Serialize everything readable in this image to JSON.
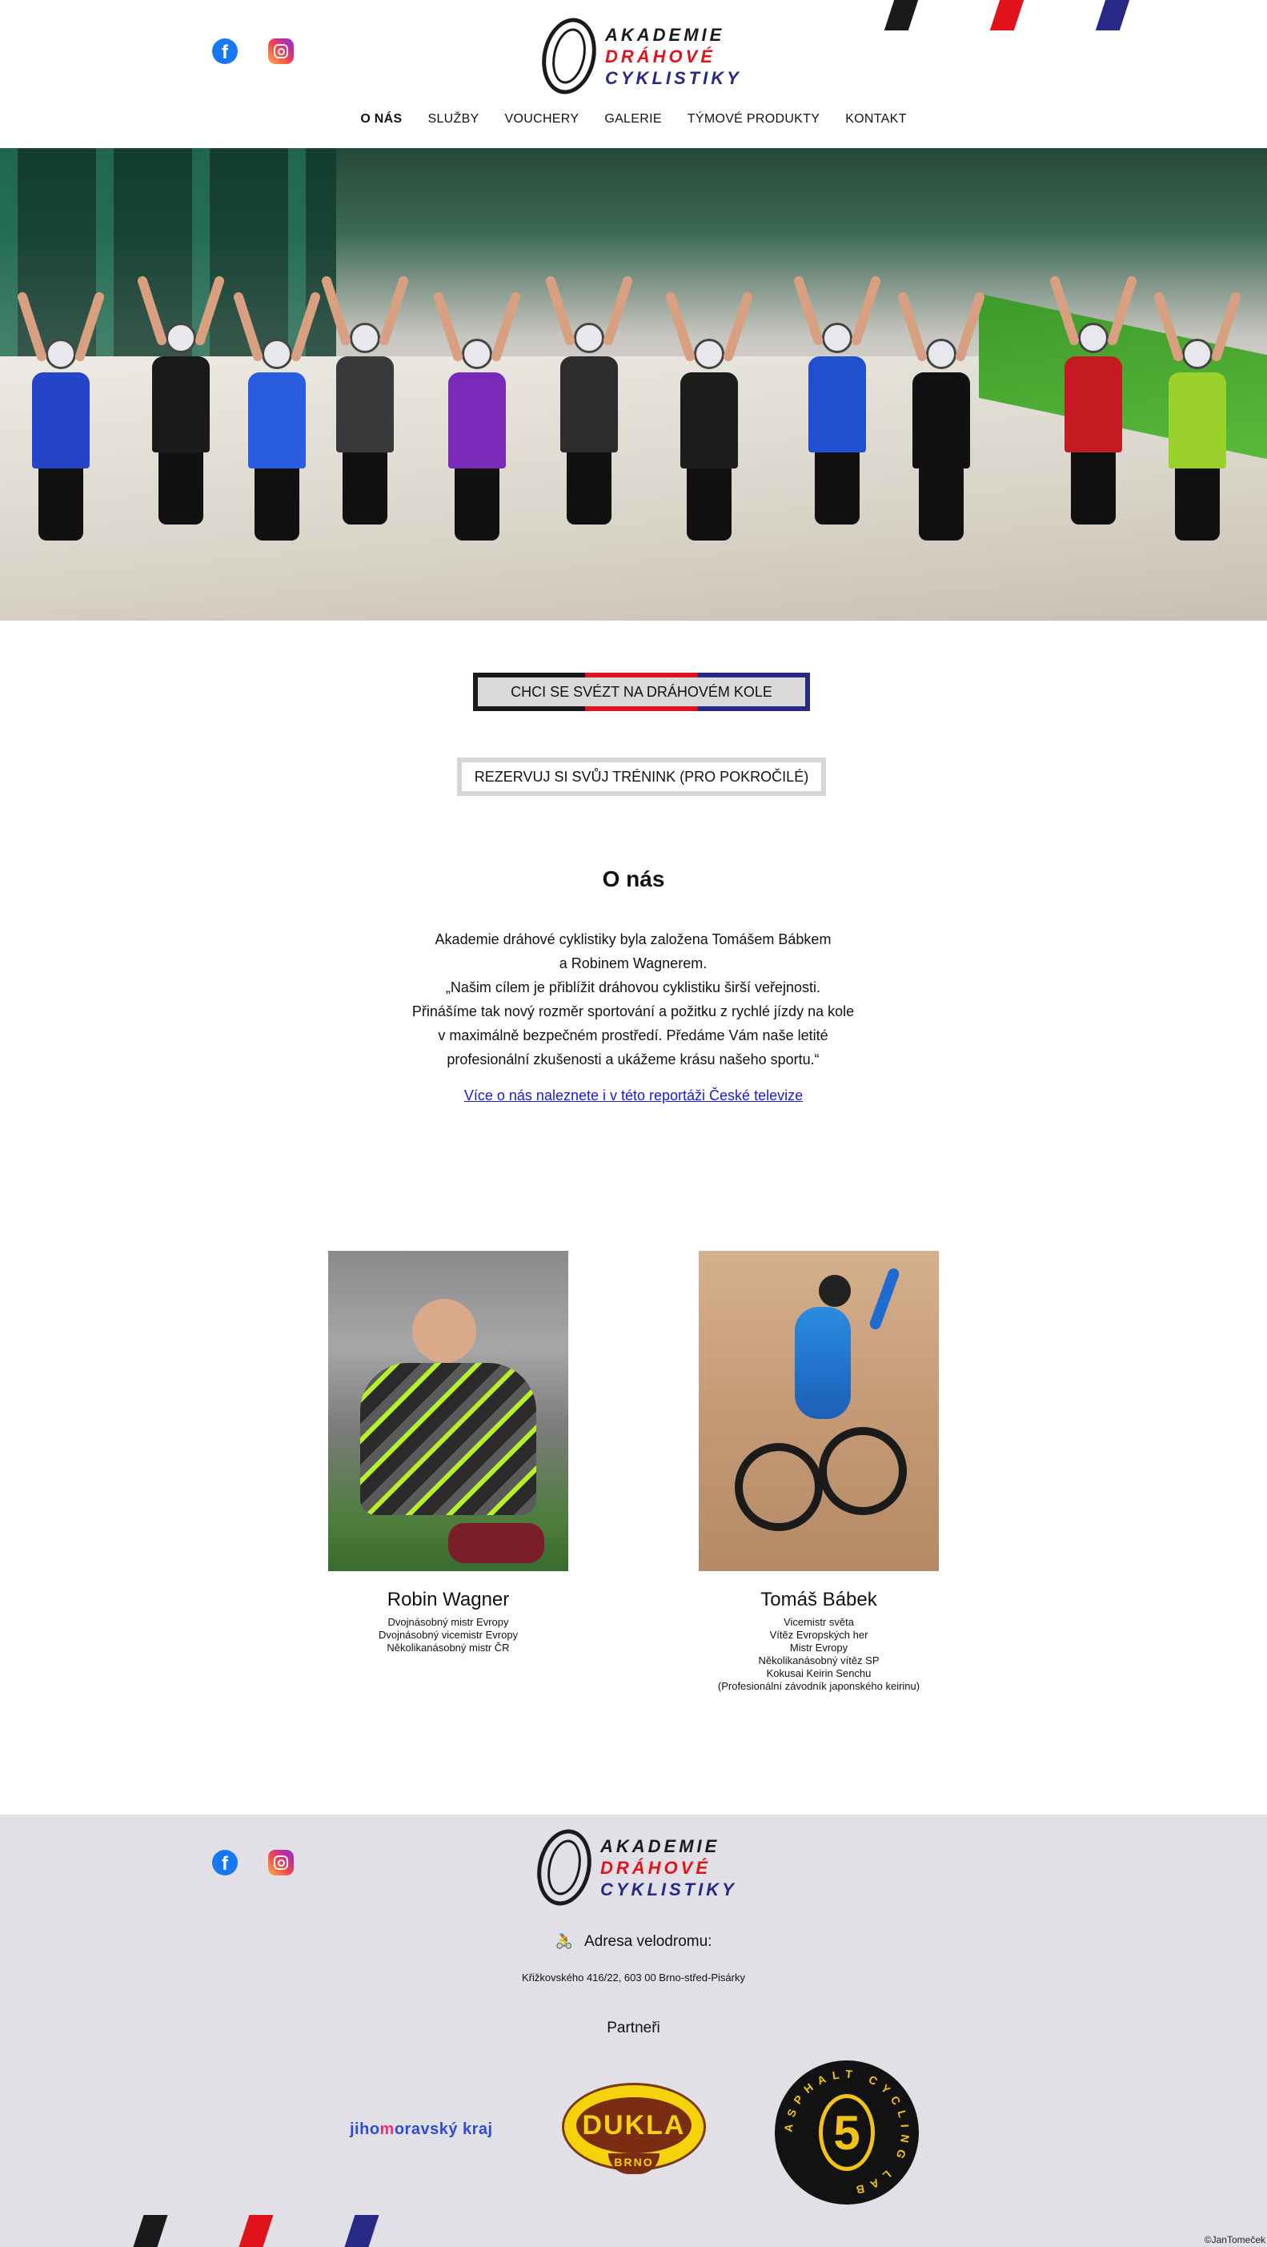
{
  "brand": {
    "line1": "AKADEMIE",
    "line2": "DRÁHOVÉ",
    "line3": "CYKLISTIKY",
    "colors": {
      "black": "#1a1a1a",
      "red": "#e0131b",
      "blue": "#262a86"
    }
  },
  "social": {
    "facebook_icon": "facebook-icon",
    "facebook_glyph": "f",
    "instagram_icon": "instagram-icon"
  },
  "nav": {
    "items": [
      {
        "label": "O NÁS",
        "active": true
      },
      {
        "label": "SLUŽBY"
      },
      {
        "label": "VOUCHERY"
      },
      {
        "label": "GALERIE"
      },
      {
        "label": "TÝMOVÉ PRODUKTY"
      },
      {
        "label": "KONTAKT"
      }
    ]
  },
  "buttons": {
    "ride": "CHCI SE SVÉZT NA DRÁHOVÉM KOLE",
    "reserve": "REZERVUJ SI SVŮJ TRÉNINK (PRO POKROČILÉ)"
  },
  "about": {
    "title": "O nás",
    "lines": [
      "Akademie dráhové cyklistiky byla založena Tomášem Bábkem",
      "a Robinem Wagnerem.",
      "„Našim cílem je přiblížit dráhovou cyklistiku širší veřejnosti.",
      "Přinášíme tak nový rozměr sportování a požitku z rychlé jízdy na kole",
      "v maximálně bezpečném prostředí. Předáme Vám naše letité",
      "profesionální zkušenosti a ukážeme krásu našeho sportu.“"
    ],
    "link": "Více o nás naleznete i v této reportáži České televize"
  },
  "people": [
    {
      "name": "Robin Wagner",
      "titles": [
        "Dvojnásobný mistr Evropy",
        "Dvojnásobný vicemistr Evropy",
        "Několikanásobný mistr ČR"
      ]
    },
    {
      "name": "Tomáš Bábek",
      "titles": [
        "Vicemistr světa",
        "Vítěz Evropských her",
        "Mistr Evropy",
        "Několikanásobný vítěz SP",
        "Kokusai Keirin Senchu",
        "(Profesionální závodník japonského keirinu)"
      ]
    }
  ],
  "footer": {
    "address_icon": "cyclist-icon",
    "address_label": "Adresa velodromu:",
    "address": "Křižkovského 416/22, 603 00 Brno-střed-Pisárky",
    "partners_title": "Partneři",
    "partners": [
      {
        "pre": "jiho",
        "mid": "m",
        "post": "oravský kraj"
      },
      {
        "name": "DUKLA",
        "sub": "BRNO"
      },
      {
        "number": "5",
        "ring": "ASPHALT CYCLING LAB"
      }
    ],
    "copyright": "©JanTomeček"
  }
}
